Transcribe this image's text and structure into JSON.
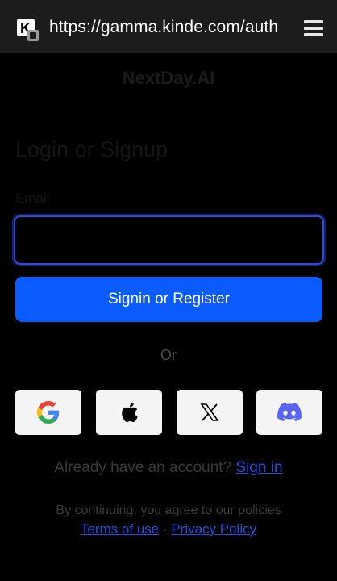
{
  "browser": {
    "url": "https://gamma.kinde.com/auth",
    "site_icon": "kinde-favicon-icon",
    "menu_icon": "tabs-menu-icon"
  },
  "brand": {
    "name": "NextDay.AI"
  },
  "form": {
    "heading": "Login or Signup",
    "email_label": "Email",
    "email_value": "",
    "submit_label": "Signin or Register"
  },
  "divider": {
    "or_label": "Or"
  },
  "social": [
    {
      "name": "google",
      "icon": "google-icon"
    },
    {
      "name": "apple",
      "icon": "apple-icon"
    },
    {
      "name": "x",
      "icon": "x-icon"
    },
    {
      "name": "discord",
      "icon": "discord-icon"
    }
  ],
  "footer": {
    "already_text": "Already have an account?",
    "signin_link": "Sign in",
    "policy_text": "By continuing, you agree to our policies",
    "terms_link": "Terms of use",
    "separator": "·",
    "privacy_link": "Privacy Policy"
  },
  "colors": {
    "primary": "#0b5cff",
    "link": "#1f4fe0",
    "background": "#000000",
    "input_border": "#2e4bd6"
  }
}
